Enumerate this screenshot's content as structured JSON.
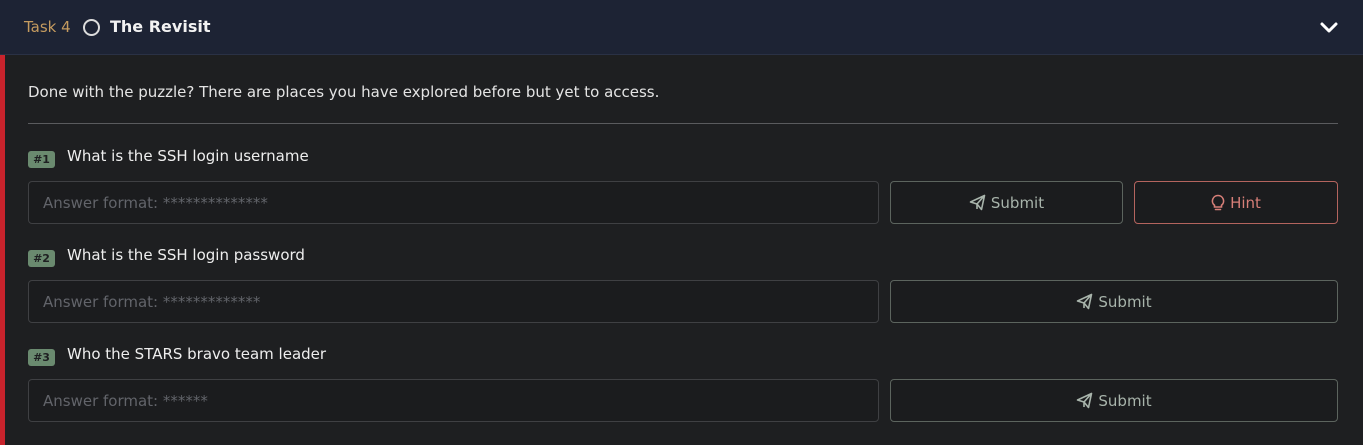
{
  "header": {
    "task_number": "Task 4",
    "title": "The Revisit"
  },
  "intro": "Done with the puzzle? There are places you have explored before but yet to access.",
  "questions": [
    {
      "badge": "#1",
      "text": "What is the SSH login username",
      "placeholder": "Answer format: **************",
      "submit_label": "Submit",
      "hint_label": "Hint"
    },
    {
      "badge": "#2",
      "text": "What is the SSH login password",
      "placeholder": "Answer format: *************",
      "submit_label": "Submit"
    },
    {
      "badge": "#3",
      "text": "Who the STARS bravo team leader",
      "placeholder": "Answer format: ******",
      "submit_label": "Submit"
    }
  ],
  "colors": {
    "accent": "#c8232c",
    "header_bg": "#1d2334",
    "badge": "#6a8a6f",
    "hint": "#d77f78"
  },
  "icons": {
    "status": "circle-outline-icon",
    "collapse": "chevron-down-icon",
    "submit": "paper-plane-icon",
    "hint": "lightbulb-icon"
  }
}
